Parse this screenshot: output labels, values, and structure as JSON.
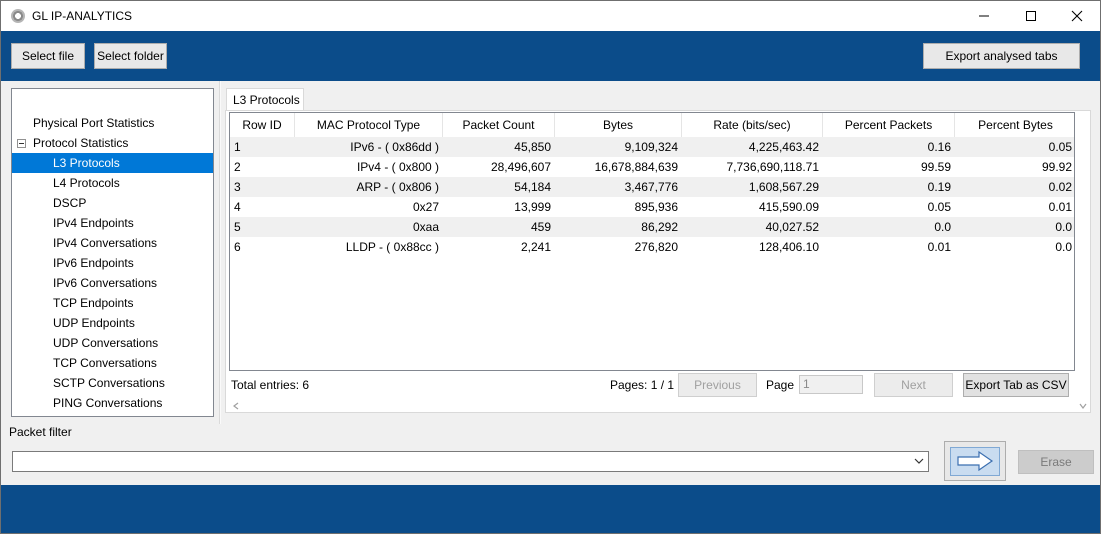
{
  "window": {
    "title": "GL IP-ANALYTICS"
  },
  "toolbar": {
    "select_file": "Select file",
    "select_folder": "Select folder",
    "export_tabs": "Export analysed tabs"
  },
  "tree": {
    "items": [
      {
        "label": "Physical Port Statistics",
        "level": 0
      },
      {
        "label": "Protocol Statistics",
        "level": 0,
        "expanded": true
      },
      {
        "label": "L3 Protocols",
        "level": 1,
        "selected": true
      },
      {
        "label": "L4 Protocols",
        "level": 1
      },
      {
        "label": "DSCP",
        "level": 1
      },
      {
        "label": "IPv4 Endpoints",
        "level": 1
      },
      {
        "label": "IPv4 Conversations",
        "level": 1
      },
      {
        "label": "IPv6 Endpoints",
        "level": 1
      },
      {
        "label": "IPv6 Conversations",
        "level": 1
      },
      {
        "label": "TCP Endpoints",
        "level": 1
      },
      {
        "label": "UDP Endpoints",
        "level": 1
      },
      {
        "label": "UDP Conversations",
        "level": 1
      },
      {
        "label": "TCP Conversations",
        "level": 1
      },
      {
        "label": "SCTP Conversations",
        "level": 1
      },
      {
        "label": "PING Conversations",
        "level": 1
      }
    ]
  },
  "tab": {
    "label": "L3 Protocols"
  },
  "table": {
    "columns": [
      "Row ID",
      "MAC Protocol Type",
      "Packet Count",
      "Bytes",
      "Rate (bits/sec)",
      "Percent Packets",
      "Percent Bytes"
    ],
    "rows": [
      [
        "1",
        "IPv6 - ( 0x86dd )",
        "45,850",
        "9,109,324",
        "4,225,463.42",
        "0.16",
        "0.05"
      ],
      [
        "2",
        "IPv4 - ( 0x800 )",
        "28,496,607",
        "16,678,884,639",
        "7,736,690,118.71",
        "99.59",
        "99.92"
      ],
      [
        "3",
        "ARP - ( 0x806 )",
        "54,184",
        "3,467,776",
        "1,608,567.29",
        "0.19",
        "0.02"
      ],
      [
        "4",
        "0x27",
        "13,999",
        "895,936",
        "415,590.09",
        "0.05",
        "0.01"
      ],
      [
        "5",
        "0xaa",
        "459",
        "86,292",
        "40,027.52",
        "0.0",
        "0.0"
      ],
      [
        "6",
        "LLDP - ( 0x88cc )",
        "2,241",
        "276,820",
        "128,406.10",
        "0.01",
        "0.0"
      ]
    ]
  },
  "footer": {
    "total_entries": "Total entries: 6",
    "pages": "Pages: 1 / 1",
    "previous": "Previous",
    "page_label": "Page",
    "page_value": "1",
    "next": "Next",
    "export_csv": "Export Tab as CSV"
  },
  "filter": {
    "label": "Packet filter",
    "value": "",
    "erase": "Erase"
  },
  "colors": {
    "brand_blue": "#0b4c8a",
    "selection": "#0078d7"
  }
}
